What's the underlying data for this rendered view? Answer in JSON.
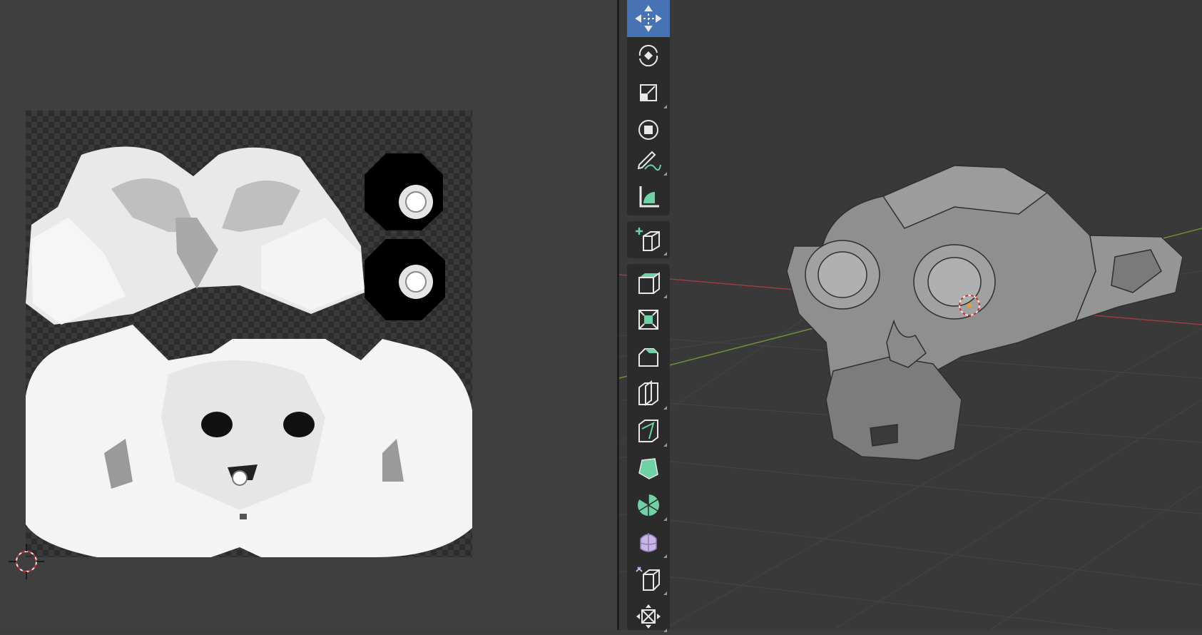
{
  "app": {
    "uv_editor": {
      "image": "uv-bake-texture"
    },
    "viewport": {
      "object": "suzanne-mesh"
    }
  },
  "toolbar": {
    "active_tool": "move",
    "tools": [
      {
        "id": "move",
        "icon": "move-icon",
        "group": 0,
        "has_submenu": false,
        "active": true
      },
      {
        "id": "rotate",
        "icon": "rotate-icon",
        "group": 0,
        "has_submenu": false
      },
      {
        "id": "scale",
        "icon": "scale-icon",
        "group": 0,
        "has_submenu": true
      },
      {
        "id": "transform",
        "icon": "transform-icon",
        "group": 0,
        "has_submenu": false
      },
      {
        "id": "annotate",
        "icon": "annotate-icon",
        "group": 1,
        "has_submenu": true
      },
      {
        "id": "measure",
        "icon": "measure-icon",
        "group": 1,
        "has_submenu": false
      },
      {
        "id": "add-cube",
        "icon": "add-cube-icon",
        "group": 2,
        "has_submenu": true
      },
      {
        "id": "extrude-region",
        "icon": "extrude-icon",
        "group": 3,
        "has_submenu": true
      },
      {
        "id": "inset-faces",
        "icon": "inset-icon",
        "group": 3,
        "has_submenu": false
      },
      {
        "id": "bevel",
        "icon": "bevel-icon",
        "group": 3,
        "has_submenu": false
      },
      {
        "id": "loop-cut",
        "icon": "loop-cut-icon",
        "group": 3,
        "has_submenu": true
      },
      {
        "id": "knife",
        "icon": "knife-icon",
        "group": 3,
        "has_submenu": true
      },
      {
        "id": "poly-build",
        "icon": "poly-build-icon",
        "group": 3,
        "has_submenu": false
      },
      {
        "id": "spin",
        "icon": "spin-icon",
        "group": 3,
        "has_submenu": true
      },
      {
        "id": "smooth",
        "icon": "smooth-icon",
        "group": 3,
        "has_submenu": true
      },
      {
        "id": "edge-slide",
        "icon": "edge-slide-icon",
        "group": 3,
        "has_submenu": true
      },
      {
        "id": "shrink-fatten",
        "icon": "shrink-fatten-icon",
        "group": 3,
        "has_submenu": true
      }
    ]
  },
  "colors": {
    "active_tool": "#4772b3",
    "x_axis": "#9b3b45",
    "y_axis": "#6e8f3a",
    "tool_accent": "#6fd1a5",
    "tool_purple": "#c7b4e8"
  }
}
